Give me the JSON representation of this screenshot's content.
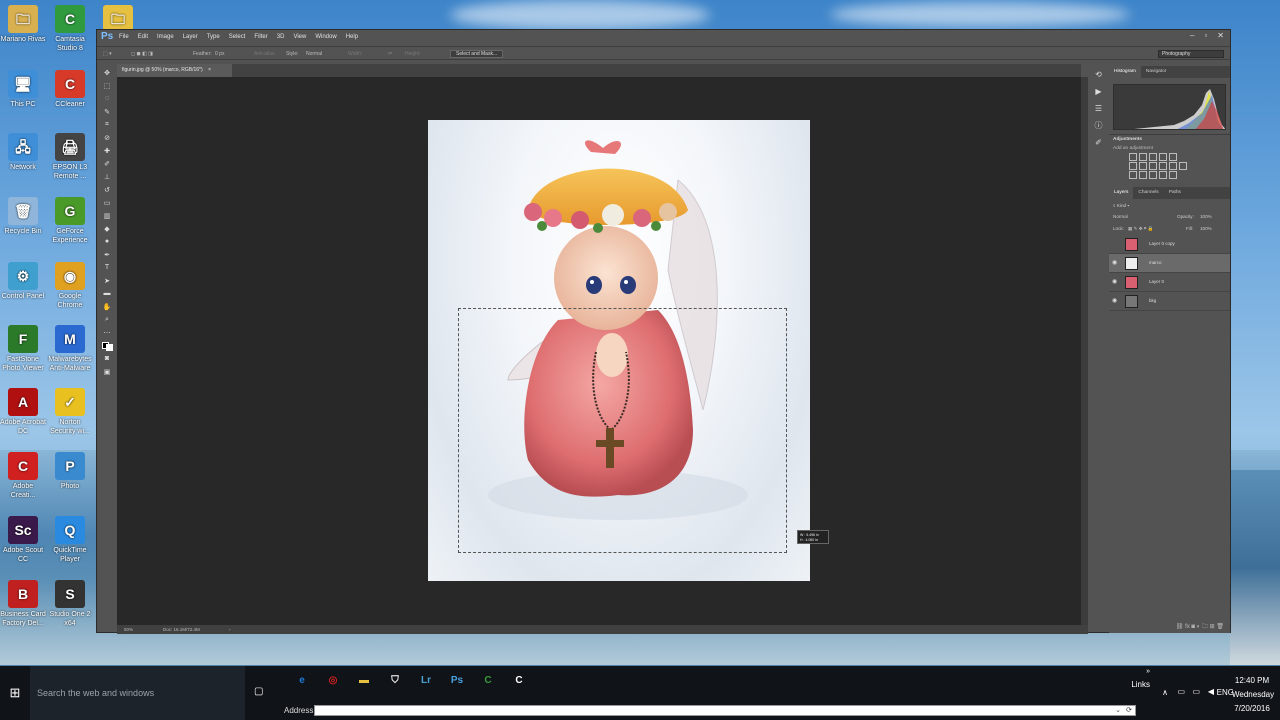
{
  "desktop": {
    "icons": [
      {
        "label": "Mariano Rivas",
        "color": "#d9b050",
        "glyph": "🗀"
      },
      {
        "label": "Camtasia Studio 8",
        "color": "#2f9a3e",
        "glyph": "C"
      },
      {
        "label": "",
        "color": "#e6c040",
        "glyph": "🗀"
      },
      {
        "label": "This PC",
        "color": "#3f8fd8",
        "glyph": "🖥"
      },
      {
        "label": "CCleaner",
        "color": "#d83a2a",
        "glyph": "C"
      },
      {
        "label": "Network",
        "color": "#3f8fd8",
        "glyph": "🖧"
      },
      {
        "label": "EPSON L3 Remote ...",
        "color": "#444",
        "glyph": "🖨"
      },
      {
        "label": "Recycle Bin",
        "color": "#8fb6da",
        "glyph": "🗑"
      },
      {
        "label": "GeForce Experience",
        "color": "#4a9a2a",
        "glyph": "G"
      },
      {
        "label": "Control Panel",
        "color": "#3fa0d0",
        "glyph": "⚙"
      },
      {
        "label": "Google Chrome",
        "color": "#e0a020",
        "glyph": "◉"
      },
      {
        "label": "FastStone Photo Viewer",
        "color": "#2a7a2a",
        "glyph": "F"
      },
      {
        "label": "Malwarebytes Anti-Malware",
        "color": "#2a6ad0",
        "glyph": "M"
      },
      {
        "label": "Adobe Acrobat DC",
        "color": "#b01010",
        "glyph": "A"
      },
      {
        "label": "Norton Security wi...",
        "color": "#e8c020",
        "glyph": "✓"
      },
      {
        "label": "Adobe Creati...",
        "color": "#d02020",
        "glyph": "C"
      },
      {
        "label": "Photo",
        "color": "#3a8ad0",
        "glyph": "P"
      },
      {
        "label": "Adobe Scout CC",
        "color": "#3a1a4a",
        "glyph": "Sc"
      },
      {
        "label": "QuickTime Player",
        "color": "#2a8ae0",
        "glyph": "Q"
      },
      {
        "label": "Business Card Factory Del...",
        "color": "#c02020",
        "glyph": "B"
      },
      {
        "label": "Studio One 2 x64",
        "color": "#333",
        "glyph": "S"
      }
    ]
  },
  "photoshop": {
    "logo": "Ps",
    "menu": [
      "File",
      "Edit",
      "Image",
      "Layer",
      "Type",
      "Select",
      "Filter",
      "3D",
      "View",
      "Window",
      "Help"
    ],
    "options": {
      "feather_label": "Feather:",
      "feather_value": "0 px",
      "antialias_label": "Anti-alias",
      "style_label": "Style:",
      "style_value": "Normal",
      "width_label": "Width:",
      "height_label": "Height:",
      "select_mask_button": "Select and Mask...",
      "workspace": "Photography"
    },
    "document_tab": "figurin.jpg @ 50% (marco, RGB/16*)",
    "status": {
      "zoom": "50%",
      "doc_size": "Doc: 16.1M/72.4M"
    },
    "marquee_readout": {
      "w": "W : 5.496 in",
      "h": "H : 4.080 in"
    },
    "panels": {
      "top_tabs": [
        "Histogram",
        "Navigator"
      ],
      "adjustments_title": "Adjustments",
      "adjustments_hint": "Add an adjustment",
      "layer_tabs": [
        "Layers",
        "Channels",
        "Paths"
      ],
      "kind_label": "Kind",
      "blend_mode": "Normal",
      "opacity_label": "Opacity:",
      "opacity_value": "100%",
      "lock_label": "Lock:",
      "fill_label": "Fill:",
      "fill_value": "100%",
      "layers": [
        {
          "name": "Layer 0 copy",
          "visible": false,
          "selected": false
        },
        {
          "name": "marco",
          "visible": true,
          "selected": true
        },
        {
          "name": "Layer 0",
          "visible": true,
          "selected": false
        },
        {
          "name": "bkg",
          "visible": true,
          "selected": false
        }
      ]
    }
  },
  "taskbar": {
    "search_placeholder": "Search the web and windows",
    "links_label": "Links",
    "language": "ENG",
    "time": "12:40 PM",
    "day": "Wednesday",
    "date": "7/20/2016",
    "address_label": "Address",
    "apps": [
      {
        "name": "edge",
        "color": "#1e7ad6",
        "glyph": "e"
      },
      {
        "name": "acrobat",
        "color": "#d02020",
        "glyph": "◎"
      },
      {
        "name": "file-explorer",
        "color": "#e8c040",
        "glyph": "▬"
      },
      {
        "name": "store",
        "color": "#fff",
        "glyph": "⛉"
      },
      {
        "name": "lightroom",
        "color": "#4aa0d0",
        "glyph": "Lr"
      },
      {
        "name": "photoshop",
        "color": "#4aa0e0",
        "glyph": "Ps"
      },
      {
        "name": "camtasia",
        "color": "#3a9a3a",
        "glyph": "C"
      },
      {
        "name": "camtasia-recorder",
        "color": "#fff",
        "glyph": "C"
      }
    ]
  },
  "colors": {
    "ps_bg": "#535353",
    "canvas_bg": "#282828",
    "accent": "#4aa0e0"
  }
}
